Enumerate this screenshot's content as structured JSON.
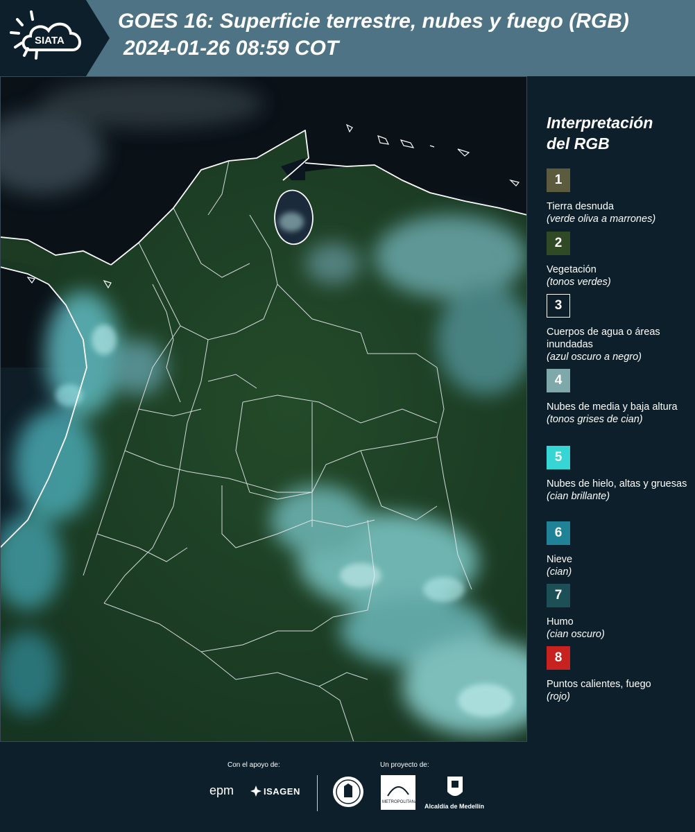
{
  "header": {
    "logo_text": "SIATA",
    "title_line1": "GOES 16: Superficie terrestre, nubes y fuego (RGB)",
    "title_line2": "2024-01-26 08:59 COT"
  },
  "legend": {
    "title_line1": "Interpretación",
    "title_line2": "del RGB",
    "items": [
      {
        "num": "1",
        "color": "#5c5b3e",
        "label": "Tierra desnuda",
        "sub": "(verde oliva a marrones)"
      },
      {
        "num": "2",
        "color": "#2f4a25",
        "label": "Vegetación",
        "sub": "(tonos verdes)"
      },
      {
        "num": "3",
        "color": "#0c1f2b",
        "label": "Cuerpos de agua o áreas inundadas",
        "sub": "(azul oscuro a negro)"
      },
      {
        "num": "4",
        "color": "#7fa8aa",
        "label": "Nubes de media y baja altura",
        "sub": "(tonos grises de cian)"
      },
      {
        "num": "5",
        "color": "#35d6d3",
        "label": "Nubes de hielo, altas y gruesas",
        "sub": "(cian brillante)"
      },
      {
        "num": "6",
        "color": "#1f8296",
        "label": "Nieve",
        "sub": "(cian)"
      },
      {
        "num": "7",
        "color": "#1d4f56",
        "label": "Humo",
        "sub": "(cian oscuro)"
      },
      {
        "num": "8",
        "color": "#c7221f",
        "label": "Puntos calientes, fuego",
        "sub": "(rojo)"
      }
    ]
  },
  "footer": {
    "support_label": "Con el apoyo de:",
    "project_label": "Un proyecto de:",
    "epm_logo": "epm",
    "isagen_logo": "ISAGEN",
    "metro_logo": "METROPOLITANA",
    "alcaldia_logo": "Alcaldía de Medellín"
  },
  "colors": {
    "header_bg": "#4d7384",
    "panel_bg": "#0c1f2b",
    "vegetation": "#1e3b22",
    "cloud": "#8fd6d6"
  }
}
